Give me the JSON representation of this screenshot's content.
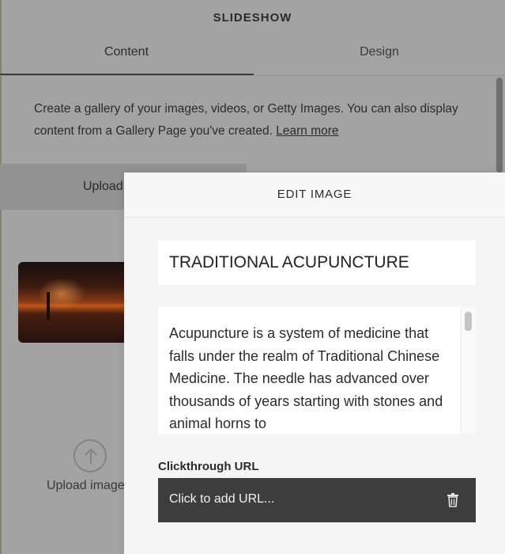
{
  "panel": {
    "title": "SLIDESHOW",
    "tabs": [
      {
        "label": "Content",
        "active": true
      },
      {
        "label": "Design",
        "active": false
      }
    ],
    "description": "Create a gallery of your images, videos, or Getty Images. You can also display content from a Gallery Page you've created.",
    "learn_more": "Learn more",
    "upload_button": "Upload",
    "upload_image_label": "Upload image"
  },
  "modal": {
    "title": "EDIT IMAGE",
    "image_title": "TRADITIONAL ACUPUNCTURE",
    "description": "Acupuncture is a system of medicine that falls under the realm of Traditional Chinese Medicine. The needle has advanced over thousands of years starting with stones and animal horns to",
    "clickthrough_label": "Clickthrough URL",
    "url_placeholder": "Click to add URL..."
  },
  "icons": {
    "upload": "upload-arrow-icon",
    "trash": "trash-icon"
  },
  "colors": {
    "overlay": "#a3a3a3",
    "modal_bg": "#f5f5f5",
    "url_field_bg": "#3d3d3d"
  }
}
